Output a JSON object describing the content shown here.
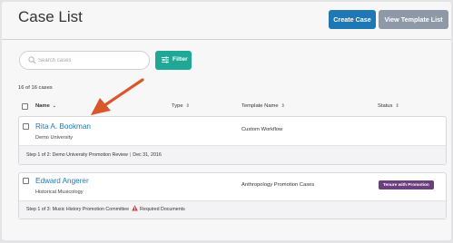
{
  "header": {
    "title": "Case List",
    "create_label": "Create Case",
    "view_template_label": "View Template List"
  },
  "toolbar": {
    "search_placeholder": "Search cases",
    "filter_label": "Filter"
  },
  "count_text": "16 of 16 cases",
  "table": {
    "columns": [
      {
        "label": "Name",
        "sort": "⌄"
      },
      {
        "label": "Type",
        "sort": "⇕"
      },
      {
        "label": "Template Name",
        "sort": "⇕"
      },
      {
        "label": "Status",
        "sort": "⇕"
      }
    ],
    "rows": [
      {
        "name": "Rita A. Bookman",
        "subtitle": "Demo University",
        "template": "Custom Workflow",
        "status": "",
        "step": "Step 1 of 2: Demo University Promotion Review",
        "date": "Dec 31, 2016"
      },
      {
        "name": "Edward Angerer",
        "subtitle": "Historical Musicology",
        "template": "Anthropology Promotion Cases",
        "status": "Tenure with Promotion",
        "step": "Step 1 of 3: Music History Promotion Committee",
        "warning": "Required Documents"
      }
    ]
  },
  "colors": {
    "primary": "#1f78b4",
    "secondary": "#8e99a8",
    "filter": "#1fa895",
    "status_badge": "#6b3e7e",
    "annotation_arrow": "#d9582b",
    "warning": "#d9382b"
  },
  "icons": [
    "search-icon",
    "filter-icon",
    "warning-icon",
    "annotation-arrow"
  ]
}
